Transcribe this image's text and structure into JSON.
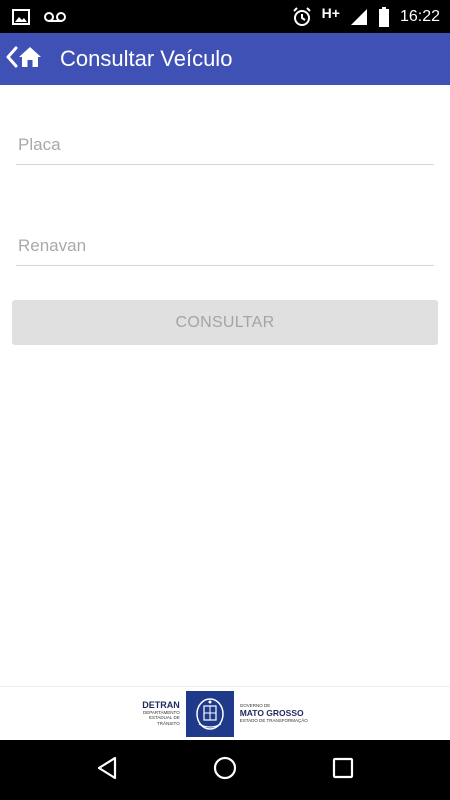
{
  "status_bar": {
    "left_icons": [
      "image-icon",
      "voicemail-icon"
    ],
    "network": "H+",
    "time": "16:22"
  },
  "app_bar": {
    "title": "Consultar Veículo",
    "background": "#3f51b5"
  },
  "form": {
    "placa": {
      "value": "",
      "placeholder": "Placa"
    },
    "renavan": {
      "value": "",
      "placeholder": "Renavan"
    },
    "submit_label": "CONSULTAR"
  },
  "footer": {
    "detran_title": "DETRAN",
    "detran_sub": [
      "DEPARTAMENTO",
      "ESTADUAL DE",
      "TRÂNSITO"
    ],
    "gov_small": "GOVERNO DE",
    "gov_title": "MATO GROSSO",
    "gov_sub": "ESTADO DE TRANSFORMAÇÃO"
  },
  "nav_bar": {
    "buttons": [
      "back-icon",
      "home-circle-icon",
      "recents-icon"
    ]
  }
}
